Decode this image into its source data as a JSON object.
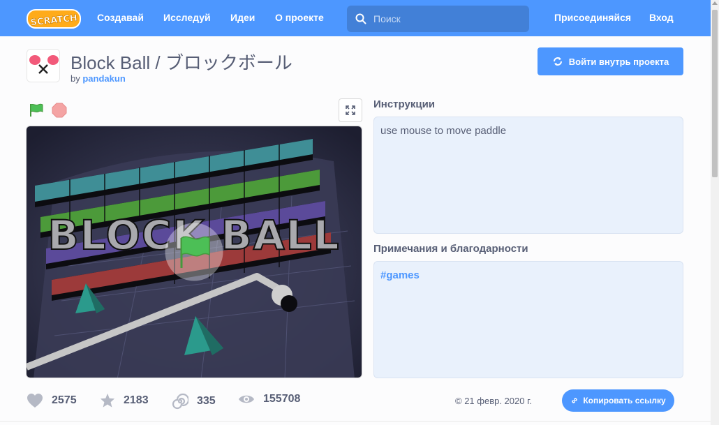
{
  "nav": {
    "logo_text": "SCRATCH",
    "links": [
      "Создавай",
      "Исследуй",
      "Идеи",
      "О проекте"
    ],
    "search_placeholder": "Поиск",
    "join": "Присоединяйся",
    "signin": "Вход"
  },
  "project": {
    "title": "Block Ball / ブロックボール",
    "by_prefix": "by",
    "author": "pandakun",
    "see_inside": "Войти внутрь проекта",
    "stage_title": "BLOCK BALL"
  },
  "instructions": {
    "label": "Инструкции",
    "text": "use mouse to move paddle"
  },
  "notes": {
    "label": "Примечания и благодарности",
    "text": "#games"
  },
  "stats": {
    "loves": "2575",
    "favorites": "2183",
    "remixes": "335",
    "views": "155708"
  },
  "footer": {
    "date": "© 21 февр. 2020 г.",
    "copy_link": "Копировать ссылку"
  },
  "colors": {
    "brand": "#4d97ff",
    "brand_dark": "#4280d7",
    "text": "#575e75",
    "panel_bg": "#e9f1fc"
  }
}
